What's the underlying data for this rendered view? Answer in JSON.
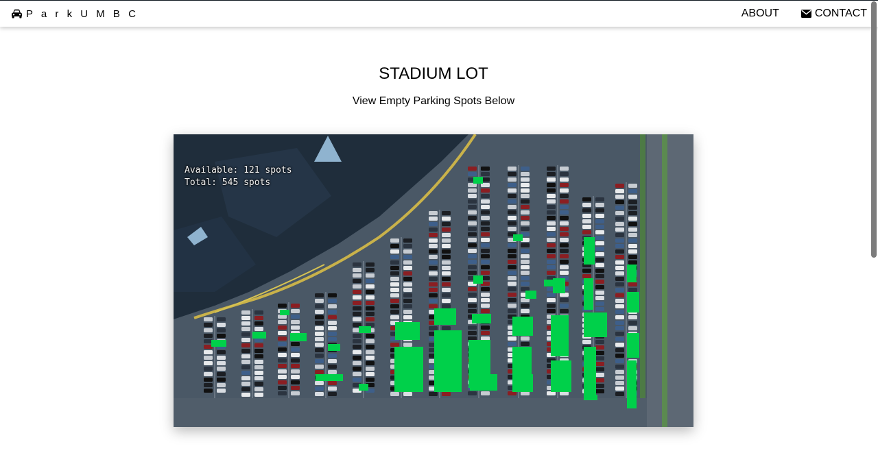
{
  "navbar": {
    "brand": "P a r k U M B C",
    "brand_icon": "car-icon",
    "links": [
      {
        "label": "ABOUT",
        "icon": null
      },
      {
        "label": "CONTACT",
        "icon": "envelope-icon"
      }
    ]
  },
  "page": {
    "title": "STADIUM LOT",
    "subtitle": "View Empty Parking Spots Below"
  },
  "feed": {
    "available_text": "Available: 121 spots",
    "total_text": "Total: 545 spots",
    "available_count": 121,
    "total_count": 545,
    "empty_spot_color": "#00d04a",
    "pavement_color": "#4a5866"
  }
}
